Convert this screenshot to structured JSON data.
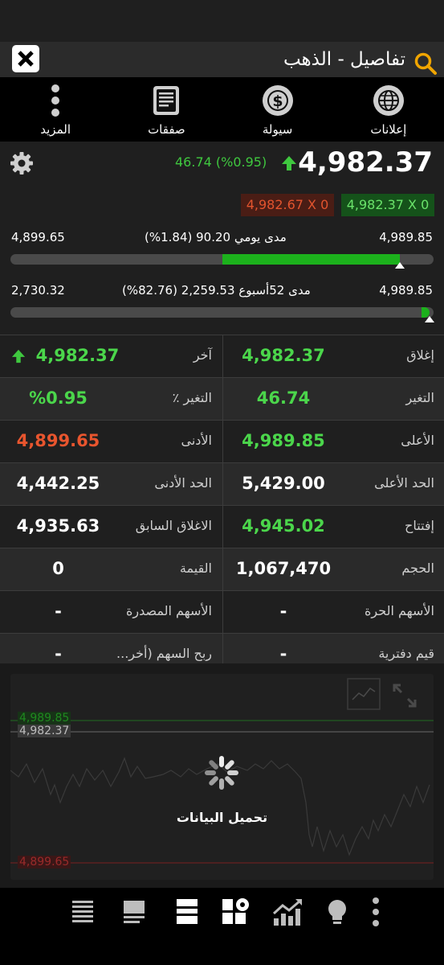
{
  "header": {
    "title": "تفاصيل - الذهب"
  },
  "toolbar": {
    "items": [
      {
        "label": "إعلانات",
        "icon": "globe-icon"
      },
      {
        "label": "سيولة",
        "icon": "dollar-icon"
      },
      {
        "label": "صفقات",
        "icon": "document-icon"
      },
      {
        "label": "المزيد",
        "icon": "more-vertical-icon"
      }
    ]
  },
  "quote": {
    "last": "4,982.37",
    "change_text": "46.74 (%0.95)",
    "ask": "4,982.67 X 0",
    "bid": "4,982.37 X 0",
    "daily_range": {
      "low": "4,899.65",
      "high": "4,989.85",
      "label": "مدى يومي 90.20 (1.84%)",
      "position": 0.92,
      "fill_start": 0.5
    },
    "week52_range": {
      "low": "2,730.32",
      "high": "4,989.85",
      "label": "مدى 52أسبوع 2,259.53 (82.76%)",
      "position": 0.99
    }
  },
  "stats": {
    "rows": [
      {
        "r_label": "إغلاق",
        "r_value": "4,982.37",
        "r_color": "green",
        "l_label": "آخر",
        "l_value": "4,982.37",
        "l_color": "green"
      },
      {
        "r_label": "التغير",
        "r_value": "46.74",
        "r_color": "green",
        "l_label": "التغير ٪",
        "l_value": "%0.95",
        "l_color": "green"
      },
      {
        "r_label": "الأعلى",
        "r_value": "4,989.85",
        "r_color": "green",
        "l_label": "الأدنى",
        "l_value": "4,899.65",
        "l_color": "red"
      },
      {
        "r_label": "الحد الأعلى",
        "r_value": "5,429.00",
        "r_color": "white",
        "l_label": "الحد الأدنى",
        "l_value": "4,442.25",
        "l_color": "white"
      },
      {
        "r_label": "إفتتاح",
        "r_value": "4,945.02",
        "r_color": "green",
        "l_label": "الاغلاق السابق",
        "l_value": "4,935.63",
        "l_color": "white"
      },
      {
        "r_label": "الحجم",
        "r_value": "1,067,470",
        "r_color": "white",
        "l_label": "القيمة",
        "l_value": "0",
        "l_color": "white"
      },
      {
        "r_label": "الأسهم الحرة",
        "r_value": "-",
        "r_color": "white",
        "l_label": "الأسهم المصدرة",
        "l_value": "-",
        "l_color": "white"
      },
      {
        "r_label": "قيم دفترية",
        "r_value": "-",
        "r_color": "white",
        "l_label": "ربح السهم (أخر...",
        "l_value": "-",
        "l_color": "white"
      }
    ]
  },
  "chart": {
    "high_label": "4,989.85",
    "last_label": "4,982.37",
    "low_label": "4,899.65",
    "loading_text": "تحميل البيانات"
  },
  "bottom_nav": {
    "icons": [
      "list-icon",
      "list-detail-icon",
      "list-selected-icon",
      "settings-grid-icon",
      "chart-up-icon",
      "lightbulb-icon",
      "more-vertical-icon"
    ]
  },
  "colors": {
    "green": "#4bd64b",
    "red": "#e8552e",
    "bar_fill": "#1cb11c"
  }
}
